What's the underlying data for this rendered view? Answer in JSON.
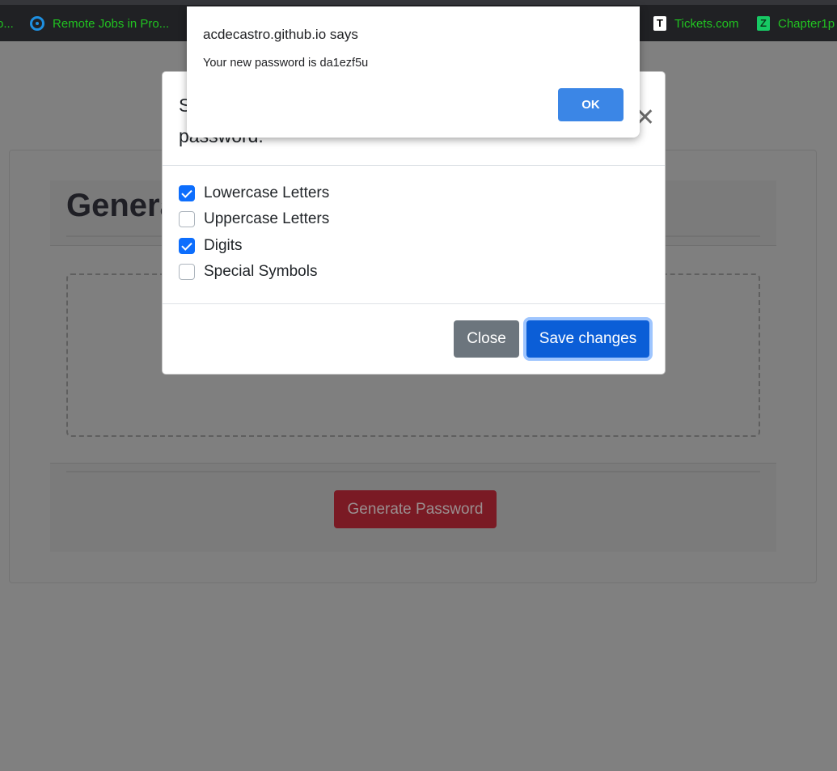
{
  "bookmarks": [
    {
      "label": "o...",
      "icon": "bookmark-partial-icon"
    },
    {
      "label": "Remote Jobs in Pro...",
      "icon": "podcast-icon"
    },
    {
      "label": "Tickets.com",
      "icon": "t-logo-icon"
    },
    {
      "label": "Chapter1p",
      "icon": "z-logo-icon"
    }
  ],
  "page": {
    "title": "Genera",
    "generate_button": "Generate Password"
  },
  "modal": {
    "title_line1": "S",
    "title_line2": "password.",
    "options": [
      {
        "label": "Lowercase Letters",
        "checked": true
      },
      {
        "label": "Uppercase Letters",
        "checked": false
      },
      {
        "label": "Digits",
        "checked": true
      },
      {
        "label": "Special Symbols",
        "checked": false
      }
    ],
    "close_button": "Close",
    "save_button": "Save changes"
  },
  "alert": {
    "title": "acdecastro.github.io says",
    "message": "Your new password is da1ezf5u",
    "ok_button": "OK"
  },
  "colors": {
    "accent": "#0d6efd",
    "danger": "#dc3545",
    "secondary": "#6c757d",
    "bookmark_text": "#21c321"
  }
}
